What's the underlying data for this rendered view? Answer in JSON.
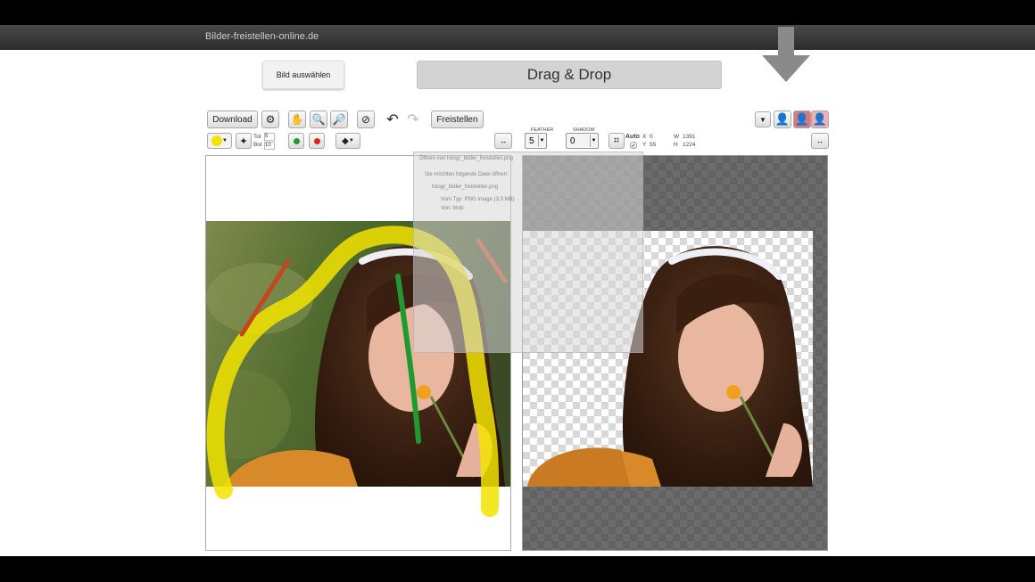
{
  "site": {
    "title": "Bilder-freistellen-online.de"
  },
  "upload": {
    "select_button": "Bild auswählen",
    "dropzone_label": "Drag & Drop"
  },
  "toolbar": {
    "download_label": "Download",
    "freistellen_label": "Freistellen",
    "tol_label": "Tol",
    "tol_value": "5",
    "bor_label": "Bor",
    "bor_value": "10",
    "feather_label": "FEATHER",
    "feather_value": "5",
    "shadow_label": "SHADOW",
    "shadow_value": "0",
    "auto_label": "Auto",
    "x_label": "X",
    "x_value": "0",
    "y_label": "Y",
    "y_value": "55",
    "w_label": "W",
    "w_value": "1391",
    "h_label": "H",
    "h_value": "1224"
  },
  "dialog": {
    "title": "Öffnen von fotogr_bilder_freistellen.png",
    "line1": "Sie möchten folgende Datei öffnen:",
    "file": "fotogr_bilder_freistellen.png",
    "type": "Vom Typ: PNG Image (3,3 MB)",
    "from": "Von: blob:"
  },
  "colors": {
    "header": "#2c2c2c",
    "dropzone": "#d3d3d3",
    "marker_yellow": "#f2e400",
    "marker_green": "#1f9a2e",
    "marker_red": "#c2471f"
  }
}
